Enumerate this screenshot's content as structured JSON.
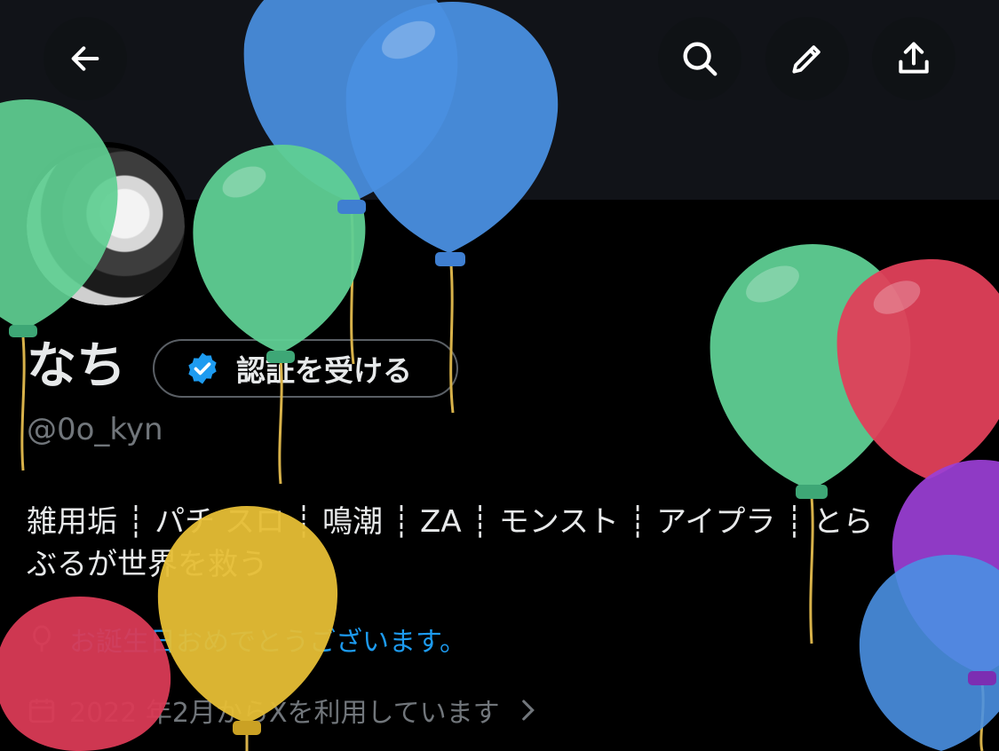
{
  "header": {
    "back_icon": "arrow-left-icon",
    "search_icon": "search-icon",
    "edit_icon": "pencil-icon",
    "share_icon": "share-icon"
  },
  "profile": {
    "name": "なち",
    "verify_label": "認証を受ける",
    "handle": "@0o_kyn",
    "bio_line1": "雑用垢 ┊ パチ スロ ┊ 鳴潮 ┊ ZA ┊ モンスト ┊ アイプラ ┊ とら",
    "bio_line2": "ぶるが世界を救う",
    "birthday_text": "お誕生日おめでとうございます。",
    "joined_text": "2022 年2月からXを利用しています"
  },
  "colors": {
    "accent": "#1d9bf0",
    "balloon_green": "#5fcf93",
    "balloon_blue": "#4a90e2",
    "balloon_red": "#e0405a",
    "balloon_yellow": "#e6be35",
    "balloon_purple": "#9b3fd6"
  }
}
